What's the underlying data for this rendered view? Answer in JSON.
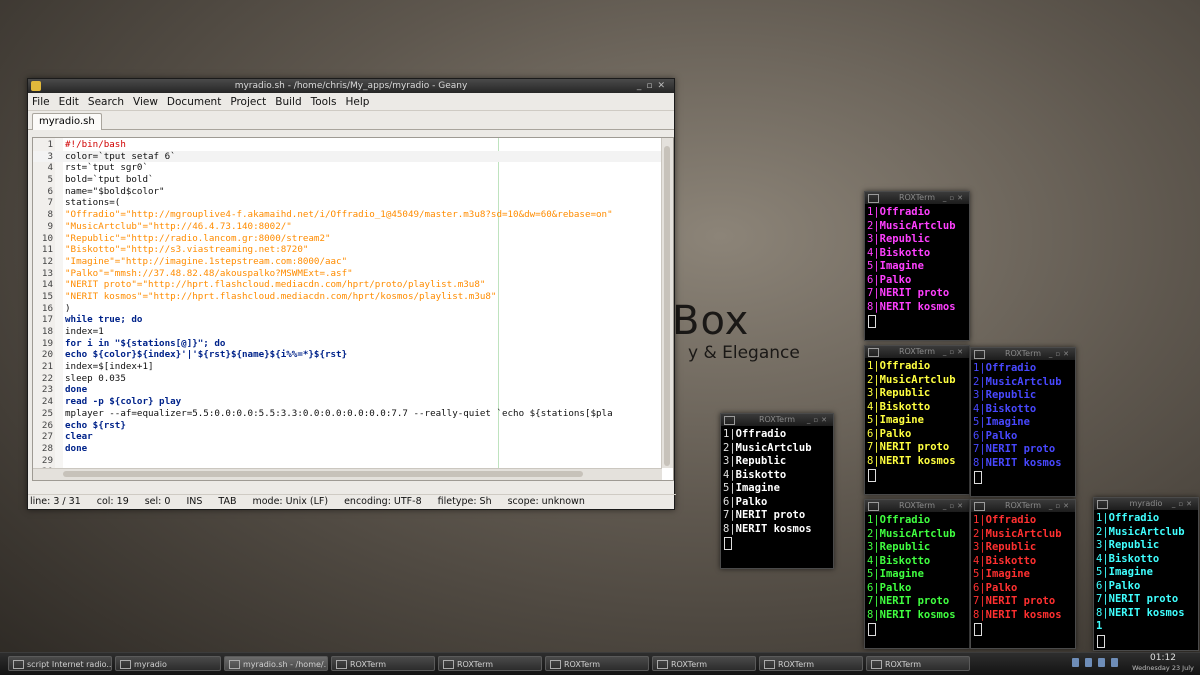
{
  "wallpaper": {
    "logo_text": "Box",
    "tagline": "y & Elegance"
  },
  "geany": {
    "title": "myradio.sh - /home/chris/My_apps/myradio - Geany",
    "menu": [
      "File",
      "Edit",
      "Search",
      "View",
      "Document",
      "Project",
      "Build",
      "Tools",
      "Help"
    ],
    "tab": "myradio.sh",
    "code_lines": [
      {
        "n": "1",
        "text": "#!/bin/bash",
        "cls": "cm"
      },
      {
        "n": "3",
        "text": "color=`tput setaf 6`",
        "cls": "cur"
      },
      {
        "n": "4",
        "text": "rst=`tput sgr0`",
        "cls": ""
      },
      {
        "n": "5",
        "text": "bold=`tput bold`",
        "cls": ""
      },
      {
        "n": "6",
        "text": "name=\"$bold$color\"",
        "cls": ""
      },
      {
        "n": "7",
        "text": "stations=(",
        "cls": ""
      },
      {
        "n": "8",
        "text": "\"Offradio\"=\"http://mgrouplive4-f.akamaihd.net/i/Offradio_1@45049/master.m3u8?sd=10&dw=60&rebase=on\"",
        "cls": "str"
      },
      {
        "n": "9",
        "text": "\"MusicArtclub\"=\"http://46.4.73.140:8002/\"",
        "cls": "str"
      },
      {
        "n": "10",
        "text": "\"Republic\"=\"http://radio.lancom.gr:8000/stream2\"",
        "cls": "str"
      },
      {
        "n": "11",
        "text": "\"Biskotto\"=\"http://s3.viastreaming.net:8720\"",
        "cls": "str"
      },
      {
        "n": "12",
        "text": "\"Imagine\"=\"http://imagine.1stepstream.com:8000/aac\"",
        "cls": "str"
      },
      {
        "n": "13",
        "text": "\"Palko\"=\"mmsh://37.48.82.48/akouspalko?MSWMExt=.asf\"",
        "cls": "str"
      },
      {
        "n": "14",
        "text": "\"NERIT proto\"=\"http://hprt.flashcloud.mediacdn.com/hprt/proto/playlist.m3u8\"",
        "cls": "str"
      },
      {
        "n": "15",
        "text": "\"NERIT kosmos\"=\"http://hprt.flashcloud.mediacdn.com/hprt/kosmos/playlist.m3u8\"",
        "cls": "str"
      },
      {
        "n": "16",
        "text": ")",
        "cls": ""
      },
      {
        "n": "17",
        "text": "while true; do",
        "cls": "kw"
      },
      {
        "n": "18",
        "text": "index=1",
        "cls": ""
      },
      {
        "n": "19",
        "text": "for i in \"${stations[@]}\"; do",
        "cls": "kw"
      },
      {
        "n": "20",
        "text": "echo ${color}${index}'|'${rst}${name}${i%%=*}${rst}",
        "cls": "kw"
      },
      {
        "n": "21",
        "text": "index=$[index+1]",
        "cls": ""
      },
      {
        "n": "22",
        "text": "sleep 0.035",
        "cls": ""
      },
      {
        "n": "23",
        "text": "done",
        "cls": "kw"
      },
      {
        "n": "24",
        "text": "read -p ${color} play",
        "cls": "kw"
      },
      {
        "n": "25",
        "text": "mplayer --af=equalizer=5.5:0.0:0.0:5.5:3.3:0.0:0.0:0.0:0.0:7.7 --really-quiet `echo ${stations[$pla",
        "cls": ""
      },
      {
        "n": "26",
        "text": "echo ${rst}",
        "cls": "kw"
      },
      {
        "n": "27",
        "text": "clear",
        "cls": "kw"
      },
      {
        "n": "28",
        "text": "done",
        "cls": "kw"
      },
      {
        "n": "29",
        "text": "",
        "cls": ""
      },
      {
        "n": "30",
        "text": "",
        "cls": ""
      },
      {
        "n": "31",
        "text": "",
        "cls": ""
      }
    ],
    "status": [
      "line: 3 / 31",
      "col: 19",
      "sel: 0",
      "INS",
      "TAB",
      "mode: Unix (LF)",
      "encoding: UTF-8",
      "filetype: Sh",
      "scope: unknown"
    ]
  },
  "stations": [
    "Offradio",
    "MusicArtclub",
    "Republic",
    "Biskotto",
    "Imagine",
    "Palko",
    "NERIT proto",
    "NERIT kosmos"
  ],
  "terminals": [
    {
      "title": "ROXTerm",
      "color": "#ff40ff",
      "num_color": "#ff40ff",
      "prompt_num": ""
    },
    {
      "title": "ROXTerm",
      "color": "#ffff40",
      "num_color": "#ffff40",
      "prompt_num": ""
    },
    {
      "title": "ROXTerm",
      "color": "#4848ff",
      "num_color": "#4848ff",
      "prompt_num": ""
    },
    {
      "title": "ROXTerm",
      "color": "#ffffff",
      "num_color": "#e0e0e0",
      "prompt_num": ""
    },
    {
      "title": "ROXTerm",
      "color": "#40ff40",
      "num_color": "#40ff40",
      "prompt_num": ""
    },
    {
      "title": "ROXTerm",
      "color": "#ff3030",
      "num_color": "#ff3030",
      "prompt_num": ""
    },
    {
      "title": "myradio",
      "color": "#40ffff",
      "num_color": "#40ffff",
      "prompt_num": "1"
    }
  ],
  "taskbar": {
    "items": [
      "script Internet radio...",
      "myradio",
      "myradio.sh - /home/...",
      "ROXTerm",
      "ROXTerm",
      "ROXTerm",
      "ROXTerm",
      "ROXTerm",
      "ROXTerm"
    ],
    "time": "01:12",
    "date": "Wednesday 23 July"
  }
}
